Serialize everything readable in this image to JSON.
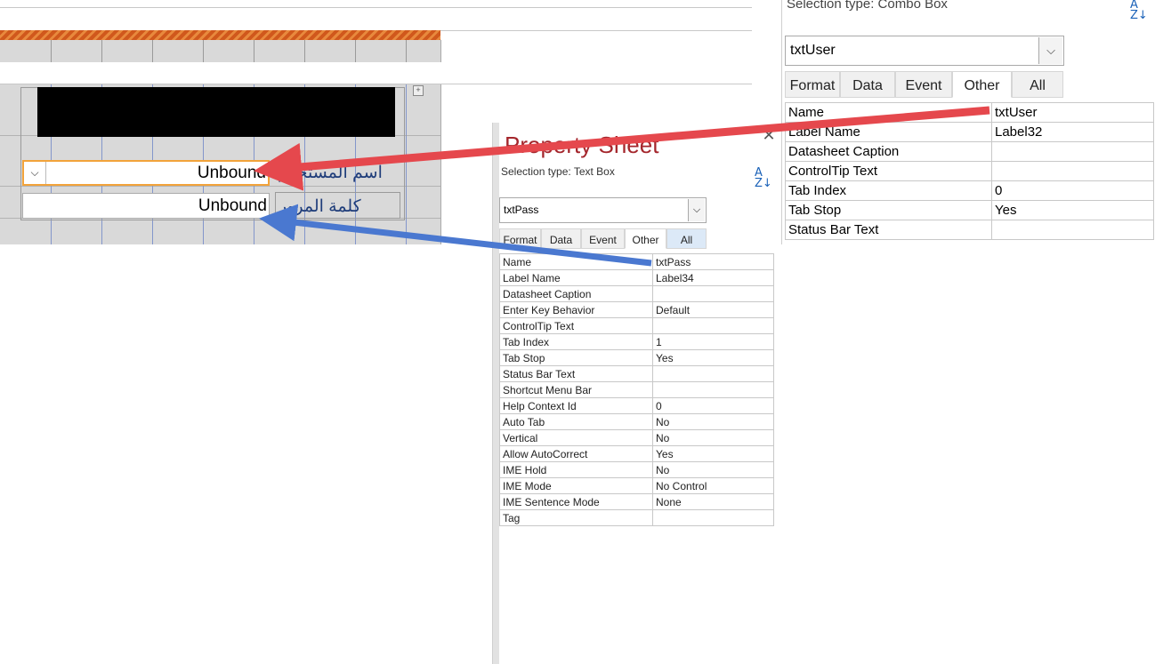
{
  "form": {
    "user_field_value": "Unbound",
    "pass_field_value": "Unbound",
    "user_label": "اسم المستخدم",
    "pass_label": "كلمة المرور"
  },
  "right_panel": {
    "selection_type": "Selection type:  Combo Box",
    "selected_object": "txtUser",
    "tabs": [
      "Format",
      "Data",
      "Event",
      "Other",
      "All"
    ],
    "active_tab": "Other",
    "properties": [
      {
        "name": "Name",
        "value": "txtUser"
      },
      {
        "name": "Label Name",
        "value": "Label32"
      },
      {
        "name": "Datasheet Caption",
        "value": ""
      },
      {
        "name": "ControlTip Text",
        "value": ""
      },
      {
        "name": "Tab Index",
        "value": "0"
      },
      {
        "name": "Tab Stop",
        "value": "Yes"
      },
      {
        "name": "Status Bar Text",
        "value": ""
      }
    ]
  },
  "property_sheet": {
    "title": "Property Sheet",
    "selection_type": "Selection type:  Text Box",
    "selected_object": "txtPass",
    "tabs": [
      "Format",
      "Data",
      "Event",
      "Other",
      "All"
    ],
    "active_tab": "Other",
    "properties": [
      {
        "name": "Name",
        "value": "txtPass"
      },
      {
        "name": "Label Name",
        "value": "Label34"
      },
      {
        "name": "Datasheet Caption",
        "value": ""
      },
      {
        "name": "Enter Key Behavior",
        "value": "Default"
      },
      {
        "name": "ControlTip Text",
        "value": ""
      },
      {
        "name": "Tab Index",
        "value": "1"
      },
      {
        "name": "Tab Stop",
        "value": "Yes"
      },
      {
        "name": "Status Bar Text",
        "value": ""
      },
      {
        "name": "Shortcut Menu Bar",
        "value": ""
      },
      {
        "name": "Help Context Id",
        "value": "0"
      },
      {
        "name": "Auto Tab",
        "value": "No"
      },
      {
        "name": "Vertical",
        "value": "No"
      },
      {
        "name": "Allow AutoCorrect",
        "value": "Yes"
      },
      {
        "name": "IME Hold",
        "value": "No"
      },
      {
        "name": "IME Mode",
        "value": "No Control"
      },
      {
        "name": "IME Sentence Mode",
        "value": "None"
      },
      {
        "name": "Tag",
        "value": ""
      }
    ]
  },
  "colors": {
    "title": "#a4262c",
    "red_arrow": "#e5484d",
    "blue_arrow": "#4a78d0",
    "selection_border": "#f2a33a"
  }
}
